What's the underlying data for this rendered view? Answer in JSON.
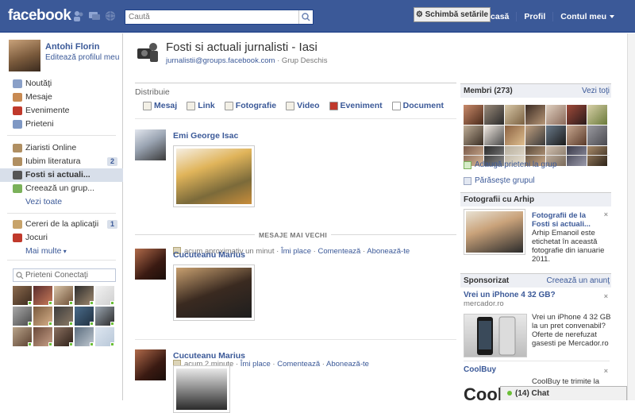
{
  "topbar": {
    "logo": "facebook",
    "search_placeholder": "Caută",
    "links": [
      "Acasă",
      "Profil",
      "Contul meu"
    ]
  },
  "profile": {
    "name": "Antohi Florin",
    "edit": "Editează profilul meu"
  },
  "nav_main": [
    {
      "label": "Noutăţi",
      "icon": "news-feed-icon",
      "color": "#8aa0c8"
    },
    {
      "label": "Mesaje",
      "icon": "messages-icon",
      "color": "#c88a52"
    },
    {
      "label": "Evenimente",
      "icon": "events-calendar-icon",
      "color": "#c0392b"
    },
    {
      "label": "Prieteni",
      "icon": "friends-icon",
      "color": "#7f98c4"
    }
  ],
  "nav_groups": [
    {
      "label": "Ziaristi Online",
      "icon": "group-icon",
      "count": ""
    },
    {
      "label": "Iubim literatura",
      "icon": "group-icon",
      "count": "2"
    },
    {
      "label": "Fosti si actuali...",
      "icon": "group-icon",
      "count": "",
      "selected": true
    },
    {
      "label": "Creează un grup...",
      "icon": "create-group-icon",
      "count": ""
    }
  ],
  "nav_groups_more": "Vezi toate",
  "nav_apps": [
    {
      "label": "Cereri de la aplicaţii",
      "icon": "app-requests-icon",
      "count": "1"
    },
    {
      "label": "Jocuri",
      "icon": "games-icon",
      "count": ""
    }
  ],
  "nav_apps_more": "Mai multe",
  "chat_search_placeholder": "Prieteni Conectaţi",
  "group": {
    "title": "Fosti si actuali jurnalisti - Iasi",
    "email": "jurnalistii@groups.facebook.com",
    "type": "Grup Deschis",
    "settings_button": "Schimbă setările"
  },
  "composer": {
    "label": "Distribuie",
    "items": [
      {
        "label": "Mesaj",
        "icon": "status-message-icon"
      },
      {
        "label": "Link",
        "icon": "link-icon"
      },
      {
        "label": "Fotografie",
        "icon": "photo-icon"
      },
      {
        "label": "Video",
        "icon": "video-icon"
      },
      {
        "label": "Eveniment",
        "icon": "event-icon"
      },
      {
        "label": "Document",
        "icon": "document-icon"
      }
    ]
  },
  "posts": [
    {
      "author": "Emi George Isac",
      "time": "acum aproximativ un minut",
      "like": "Îmi place",
      "comment": "Comentează",
      "follow": "Abonează-te"
    },
    {
      "author": "Cucuteanu Marius",
      "time": "acum 2 minute",
      "like": "Îmi place",
      "comment": "Comentează",
      "follow": "Abonează-te"
    },
    {
      "author": "Cucuteanu Marius"
    }
  ],
  "older_posts_label": "MESAJE MAI VECHI",
  "members": {
    "header": "Membri (273)",
    "see_all": "Vezi toţi",
    "add_friends": "Adaugă prieteni la grup",
    "leave": "Părăseşte grupul"
  },
  "photos_box": {
    "header": "Fotografii cu Arhip",
    "title": "Fotografii de la Fosti si actuali...",
    "text": "Arhip Emanoil este etichetat în această fotografie din ianuarie 2011.",
    "close": "×"
  },
  "sponsored": {
    "header": "Sponsorizat",
    "create_ad": "Creează un anunţ",
    "ads": [
      {
        "title": "Vrei un iPhone 4 32 GB?",
        "source": "mercador.ro",
        "text": "Vrei un iPhone 4 32 GB la un pret convenabil? Oferte de nerefuzat gasesti pe Mercador.ro",
        "close": "×"
      },
      {
        "title": "CoolBuy",
        "source": "",
        "text": "CoolBuy te trimite la",
        "close": "×"
      }
    ]
  },
  "chat": {
    "label": "(14) Chat"
  },
  "colors": {
    "brand_blue": "#3b5998",
    "online_green": "#6bbf36"
  }
}
